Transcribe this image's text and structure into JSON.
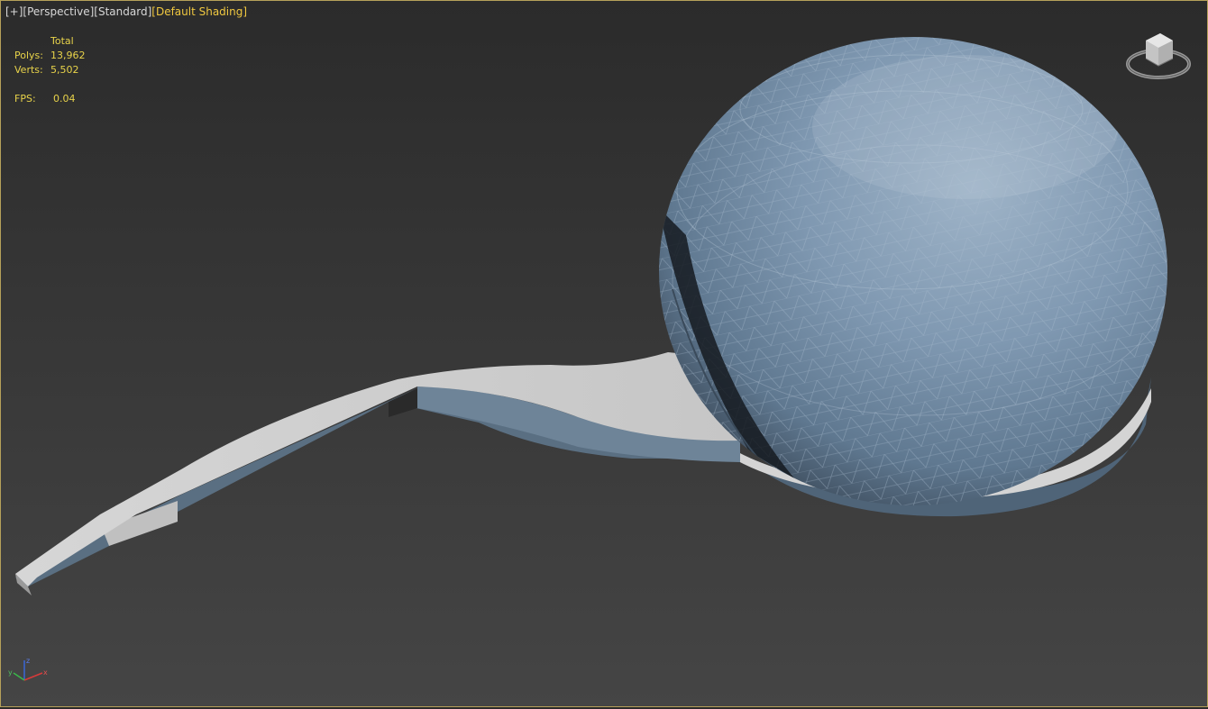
{
  "viewport": {
    "labels": [
      "[+]",
      "[Perspective]",
      "[Standard]",
      "[Default Shading]"
    ],
    "active_label_index": 3
  },
  "stats": {
    "header": "Total",
    "polys_label": "Polys:",
    "polys_value": "13,962",
    "verts_label": "Verts:",
    "verts_value": "5,502",
    "fps_label": "FPS:",
    "fps_value": "0.04"
  },
  "colors": {
    "border_active": "#b6a15a",
    "stats_text": "#e8d34a",
    "sphere": "#7f98b1",
    "walkway": "#c8c8c8"
  },
  "icons": {
    "viewcube": "viewcube-icon",
    "axis": "axis-tripod-icon"
  },
  "axis": {
    "x": "x",
    "y": "y",
    "z": "z"
  }
}
